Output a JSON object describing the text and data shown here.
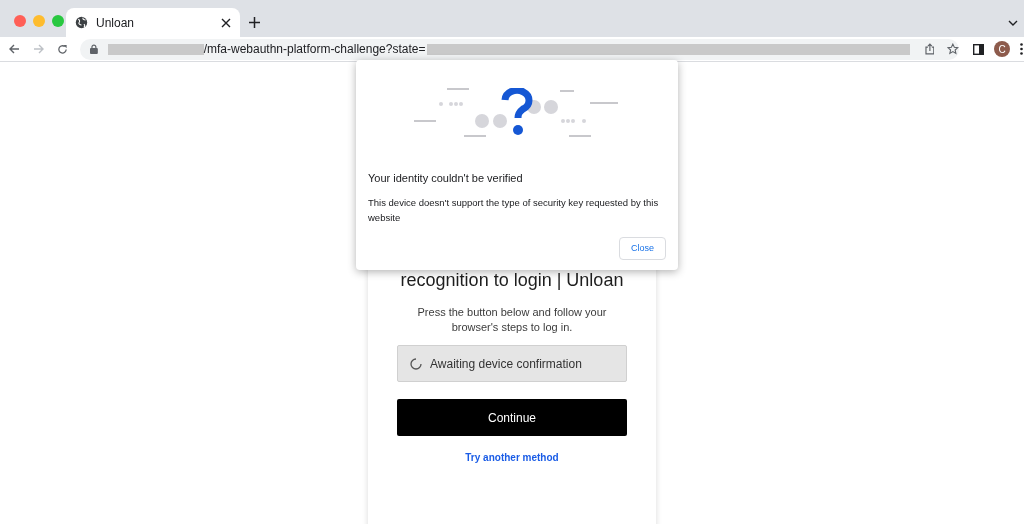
{
  "browser": {
    "tab": {
      "title": "Unloan",
      "selected": true
    },
    "address": {
      "text": "/mfa-webauthn-platform-challenge?state="
    },
    "profile": {
      "initial": "C"
    }
  },
  "card": {
    "heading": "recognition to login | Unloan",
    "instructions": "Press the button below and follow your browser's steps to log in.",
    "status": "Awaiting device confirmation",
    "continue_button": "Continue",
    "link": "Try another method"
  },
  "dialog": {
    "title": "Your identity couldn't be verified",
    "message": "This device doesn't support the type of security key requested by this website",
    "close_button": "Close"
  }
}
